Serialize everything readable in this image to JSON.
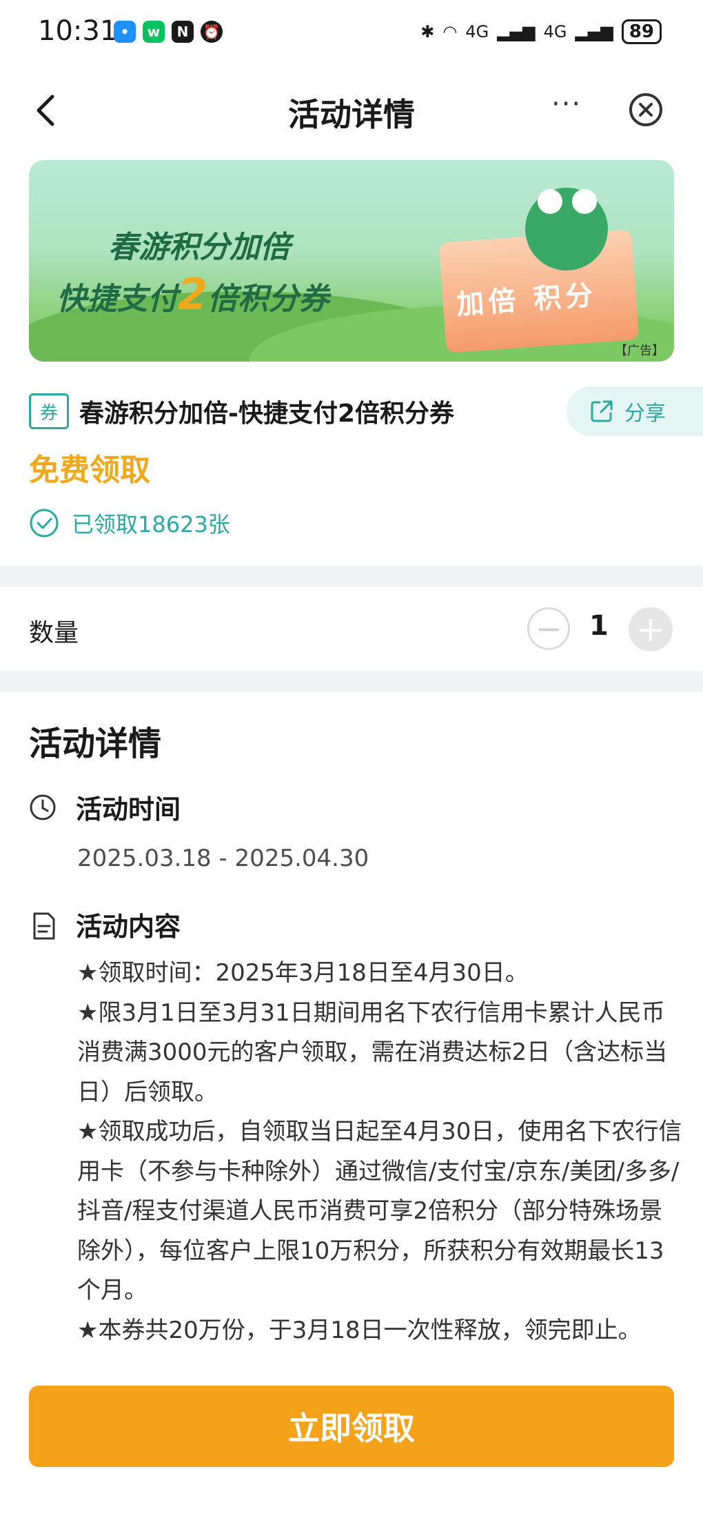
{
  "status_bar": {
    "time": "10:31",
    "signal1": "4G",
    "signal2": "4G",
    "battery": "89"
  },
  "nav": {
    "title": "活动详情",
    "more": "···"
  },
  "banner": {
    "line1": "春游积分加倍",
    "line2_prefix": "快捷支付",
    "line2_big": "2",
    "line2_suffix": "倍积分券",
    "box_text": "加倍 积分",
    "ad_tag": "【广告】"
  },
  "coupon": {
    "tag": "券",
    "title": "春游积分加倍-快捷支付2倍积分券",
    "share_label": "分享",
    "price_label": "免费领取",
    "claimed_text": "已领取18623张"
  },
  "quantity": {
    "label": "数量",
    "value": "1",
    "minus": "−",
    "plus": "+"
  },
  "details": {
    "heading": "活动详情",
    "time_label": "活动时间",
    "time_value": "2025.03.18 - 2025.04.30",
    "content_label": "活动内容",
    "content_lines": [
      "★领取时间：2025年3月18日至4月30日。",
      "★限3月1日至3月31日期间用名下农行信用卡累计人民币消费满3000元的客户领取，需在消费达标2日（含达标当日）后领取。",
      "★领取成功后，自领取当日起至4月30日，使用名下农行信用卡（不参与卡种除外）通过微信/支付宝/京东/美团/多多/抖音/程支付渠道人民币消费可享2倍积分（部分特殊场景除外），每位客户上限10万积分，所获积分有效期最长13个月。",
      "★本券共20万份，于3月18日一次性释放，领完即止。"
    ]
  },
  "cta": {
    "label": "立即领取"
  },
  "colors": {
    "accent_orange": "#f4a21a",
    "accent_teal": "#29a9a0"
  }
}
